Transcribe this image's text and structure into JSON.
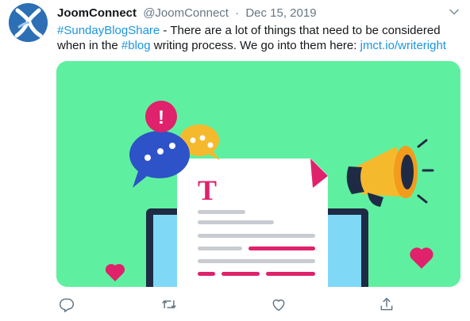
{
  "tweet": {
    "author_name": "JoomConnect",
    "author_handle": "@JoomConnect",
    "separator": "·",
    "date": "Dec 15, 2019",
    "text": {
      "hashtag1": "#SundayBlogShare",
      "part1": " - There are a lot of things that need to be considered when in the ",
      "hashtag2": "#blog",
      "part2": " writing process. We go into them here: ",
      "url": "jmct.io/writeright"
    },
    "media": {
      "illustration_letter": "T",
      "background_color": "#5ef0a0"
    },
    "actions": [
      {
        "name": "reply",
        "icon": "reply-icon"
      },
      {
        "name": "retweet",
        "icon": "retweet-icon"
      },
      {
        "name": "like",
        "icon": "heart-icon"
      },
      {
        "name": "share",
        "icon": "share-icon"
      }
    ]
  },
  "colors": {
    "link": "#1b95e0",
    "muted": "#657786",
    "avatar": "#2c6fb4"
  }
}
